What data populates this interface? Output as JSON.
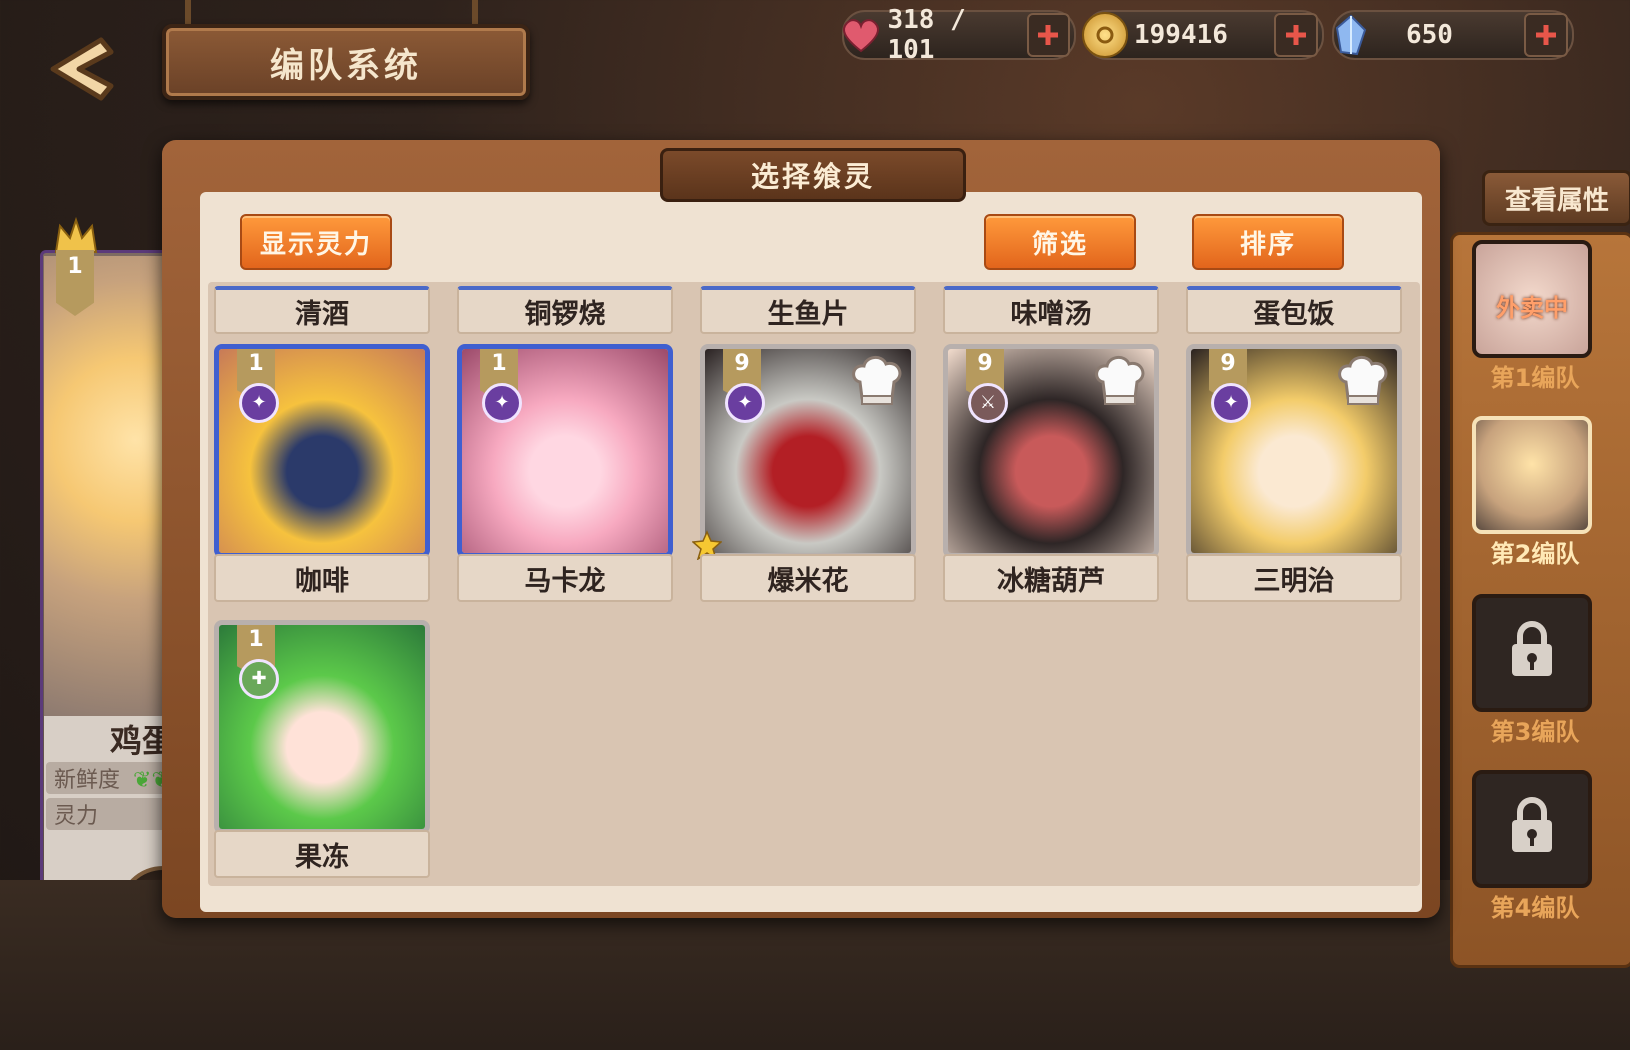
{
  "header": {
    "title": "编队系统",
    "resources": [
      {
        "icon": "heart-icon",
        "value": "318 / 101",
        "color": "#e05a6e"
      },
      {
        "icon": "coin-icon",
        "value": "199416",
        "color": "#e8b43a"
      },
      {
        "icon": "crystal-icon",
        "value": "650",
        "color": "#7fa6e8"
      }
    ]
  },
  "left_character": {
    "level": "1",
    "name": "鸡蛋",
    "freshness_label": "新鲜度",
    "power_label": "灵力"
  },
  "panel": {
    "title": "选择飨灵",
    "buttons": {
      "show_power": "显示灵力",
      "filter": "筛选",
      "sort": "排序"
    },
    "top_row_names": [
      "清酒",
      "铜锣烧",
      "生鱼片",
      "味噌汤",
      "蛋包饭"
    ],
    "cards": [
      {
        "name": "咖啡",
        "level": "1",
        "frame": "blue",
        "badge": "star-badge-icon",
        "chef": false,
        "palette": [
          "#f6c23e",
          "#2b3a6a",
          "#c77a58"
        ]
      },
      {
        "name": "马卡龙",
        "level": "1",
        "frame": "blue",
        "badge": "star-badge-icon",
        "chef": false,
        "palette": [
          "#f7a9c0",
          "#ffd7e2",
          "#9b4a6a"
        ]
      },
      {
        "name": "爆米花",
        "level": "9",
        "frame": "gray",
        "badge": "star-badge-icon",
        "chef": true,
        "starred": true,
        "palette": [
          "#c9c9c4",
          "#b31f25",
          "#2a2222"
        ]
      },
      {
        "name": "冰糖葫芦",
        "level": "9",
        "frame": "gray",
        "badge": "sword-badge-icon",
        "chef": true,
        "palette": [
          "#2e2626",
          "#c85a5a",
          "#f2dccd"
        ]
      },
      {
        "name": "三明治",
        "level": "9",
        "frame": "gray",
        "badge": "star-badge-icon",
        "chef": true,
        "palette": [
          "#f3cc6a",
          "#fbe9d2",
          "#2a2220"
        ]
      },
      {
        "name": "果冻",
        "level": "1",
        "frame": "gray",
        "badge": "cross-badge-icon",
        "chef": false,
        "palette": [
          "#5cc94a",
          "#ffe2d8",
          "#2c7a3a"
        ]
      }
    ]
  },
  "right_panel": {
    "view_attributes": "查看属性",
    "teams": [
      {
        "label": "第1编队",
        "status": "外卖中",
        "active": false,
        "locked": false
      },
      {
        "label": "第2编队",
        "status": "",
        "active": true,
        "locked": false
      },
      {
        "label": "第3编队",
        "status": "",
        "active": false,
        "locked": true
      },
      {
        "label": "第4编队",
        "status": "",
        "active": false,
        "locked": true
      }
    ]
  }
}
